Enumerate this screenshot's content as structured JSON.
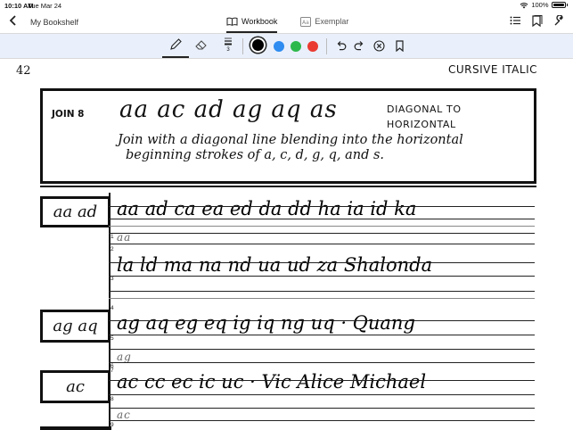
{
  "status": {
    "time": "10:10 AM",
    "date": "Tue Mar 24",
    "battery": "100%"
  },
  "nav": {
    "back_label": "My Bookshelf",
    "tabs": [
      {
        "label": "Workbook"
      },
      {
        "label": "Exemplar"
      }
    ]
  },
  "toolbar": {
    "line_width": "3",
    "colors": [
      "#000000",
      "#2f8cf0",
      "#2db84c",
      "#ea3b32"
    ]
  },
  "page": {
    "number": "42",
    "section": "CURSIVE ITALIC",
    "join": {
      "label": "JOIN 8",
      "pairs": "aa ac ad ag aq as",
      "type_line1": "DIAGONAL TO",
      "type_line2": "HORIZONTAL",
      "desc_line1": "Join with a diagonal line blending into the horizontal",
      "desc_line2": "beginning strokes of a, c, d, g, q, and s."
    },
    "rows": [
      {
        "box": "aa ad",
        "text": "aa ad ca ea ed da dd ha ia id ka"
      },
      {
        "num": "1",
        "trace": "aa"
      },
      {
        "num": "2",
        "text": "la ld ma na nd ua ud za Shalonda"
      },
      {
        "num": "3"
      },
      {
        "num": "4",
        "box": "ag aq",
        "text": "ag aq eg eq ig iq ng uq · Quang"
      },
      {
        "num": "5"
      },
      {
        "num": "6",
        "trace": "ag"
      },
      {
        "num": "7",
        "box": "ac",
        "text": "ac cc ec ic uc · Vic Alice Michael"
      },
      {
        "num": "8"
      },
      {
        "num": "9",
        "trace": "ac"
      }
    ]
  }
}
